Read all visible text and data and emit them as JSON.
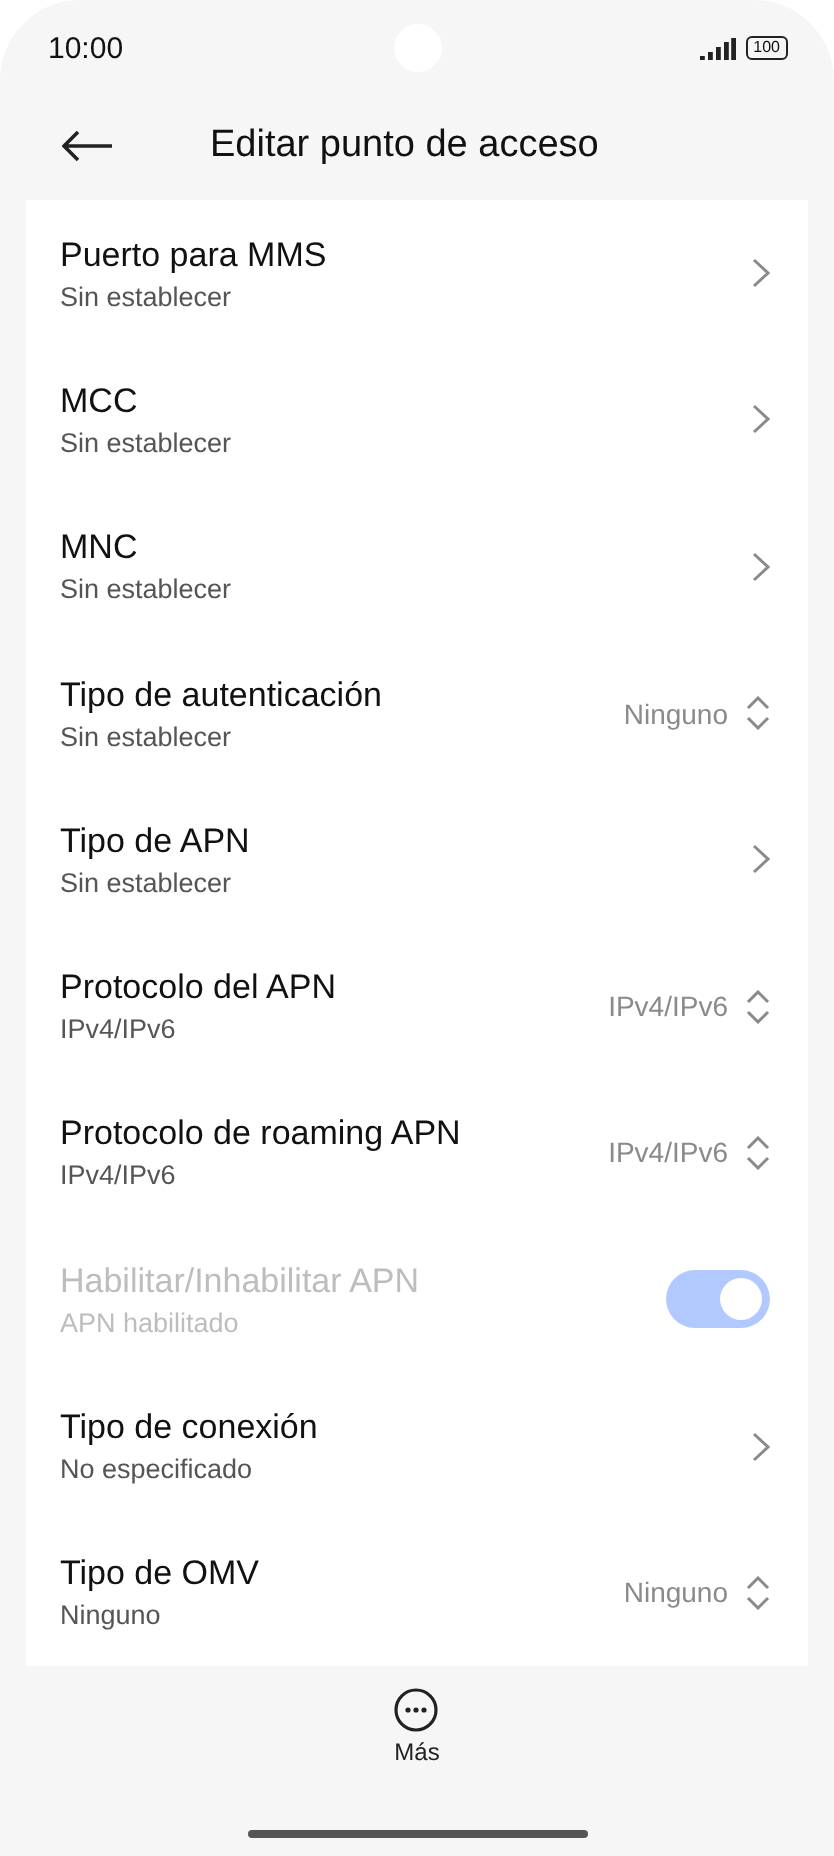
{
  "status_bar": {
    "time": "10:00",
    "battery": "100"
  },
  "header": {
    "title": "Editar punto de acceso"
  },
  "settings": [
    {
      "kind": "link",
      "title": "Puerto para MMS",
      "subtitle": "Sin establecer",
      "disabled": false
    },
    {
      "kind": "link",
      "title": "MCC",
      "subtitle": "Sin establecer",
      "disabled": false
    },
    {
      "kind": "link",
      "title": "MNC",
      "subtitle": "Sin establecer",
      "disabled": false
    },
    {
      "kind": "select",
      "title": "Tipo de autenticación",
      "subtitle": "Sin establecer",
      "value": "Ninguno",
      "disabled": false
    },
    {
      "kind": "link",
      "title": "Tipo de APN",
      "subtitle": "Sin establecer",
      "disabled": false
    },
    {
      "kind": "select",
      "title": "Protocolo del APN",
      "subtitle": "IPv4/IPv6",
      "value": "IPv4/IPv6",
      "disabled": false
    },
    {
      "kind": "select",
      "title": "Protocolo de roaming APN",
      "subtitle": "IPv4/IPv6",
      "value": "IPv4/IPv6",
      "disabled": false
    },
    {
      "kind": "toggle",
      "title": "Habilitar/Inhabilitar APN",
      "subtitle": "APN habilitado",
      "on": true,
      "disabled": true
    },
    {
      "kind": "link",
      "title": "Tipo de conexión",
      "subtitle": "No especificado",
      "disabled": false
    },
    {
      "kind": "select",
      "title": "Tipo de OMV",
      "subtitle": "Ninguno",
      "value": "Ninguno",
      "disabled": false
    }
  ],
  "bottom_bar": {
    "more_label": "Más"
  }
}
